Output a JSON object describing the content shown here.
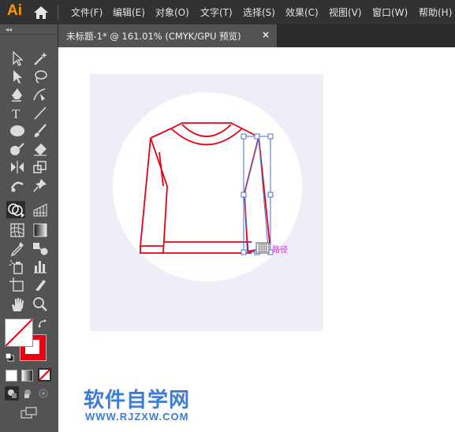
{
  "app": {
    "logo_text": "Ai"
  },
  "menu": [
    {
      "label": "文件(F)"
    },
    {
      "label": "编辑(E)"
    },
    {
      "label": "对象(O)"
    },
    {
      "label": "文字(T)"
    },
    {
      "label": "选择(S)"
    },
    {
      "label": "效果(C)"
    },
    {
      "label": "视图(V)"
    },
    {
      "label": "窗口(W)"
    },
    {
      "label": "帮助(H)"
    }
  ],
  "document_tab": {
    "title": "未标题-1* @ 161.01% (CMYK/GPU 预览)",
    "close_glyph": "×"
  },
  "toolbar": {
    "collapse_glyph": "◂◂",
    "tools": [
      "selection-tool",
      "magic-wand-tool",
      "direct-selection-tool",
      "lasso-tool",
      "pen-tool",
      "curvature-tool",
      "type-tool",
      "line-segment-tool",
      "ellipse-tool",
      "paintbrush-tool",
      "shaper-tool",
      "eraser-tool",
      "width-tool",
      "scale-tool",
      "puppet-warp-tool",
      "pin-tool",
      "shape-builder-tool",
      "perspective-grid-tool",
      "mesh-tool",
      "gradient-tool",
      "eyedropper-tool",
      "blend-tool",
      "symbol-sprayer-tool",
      "column-graph-tool",
      "artboard-tool",
      "slice-tool",
      "hand-tool",
      "zoom-tool"
    ],
    "type_tool_glyph": "T",
    "fill_color": "#ffffff",
    "stroke_color": "#e60012"
  },
  "canvas": {
    "artboard_color": "#eeeef8",
    "circle_color": "#ffffff",
    "stroke_color": "#e60012",
    "selection_color": "#4a6fd6",
    "path_label": "路径"
  },
  "watermark": {
    "text": "软件自学网",
    "url": "WWW.RJZXW.COM",
    "color": "#3d7cd4"
  }
}
